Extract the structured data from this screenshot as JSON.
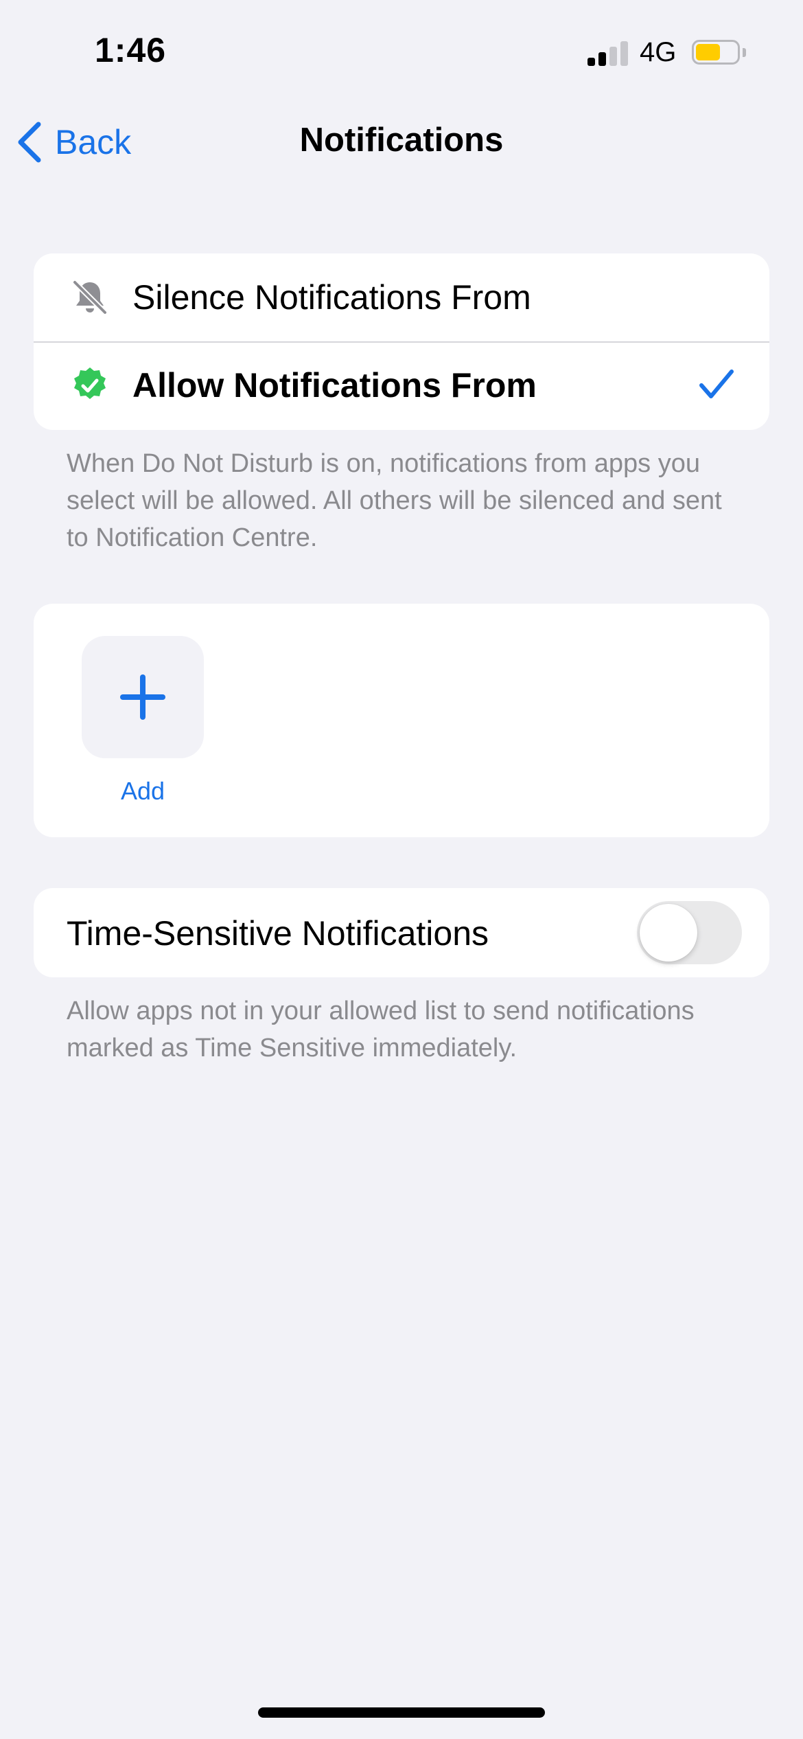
{
  "status_bar": {
    "time": "1:46",
    "network": "4G",
    "signal_bars_filled": 2,
    "signal_bars_total": 4,
    "battery_level": 0.6,
    "battery_color": "#ffcc00"
  },
  "nav": {
    "back_label": "Back",
    "title": "Notifications",
    "accent_color": "#1a73e8"
  },
  "mode_options": [
    {
      "label": "Silence Notifications From",
      "icon": "bell-slash-icon",
      "selected": false
    },
    {
      "label": "Allow Notifications From",
      "icon": "green-check-badge-icon",
      "selected": true
    }
  ],
  "mode_footnote": "When Do Not Disturb is on, notifications from apps you select will be allowed. All others will be silenced and sent to Notification Centre.",
  "apps": {
    "add_label": "Add",
    "add_icon": "plus-icon"
  },
  "time_sensitive": {
    "label": "Time-Sensitive Notifications",
    "enabled": false,
    "footnote": "Allow apps not in your allowed list to send notifications marked as Time Sensitive immediately."
  }
}
